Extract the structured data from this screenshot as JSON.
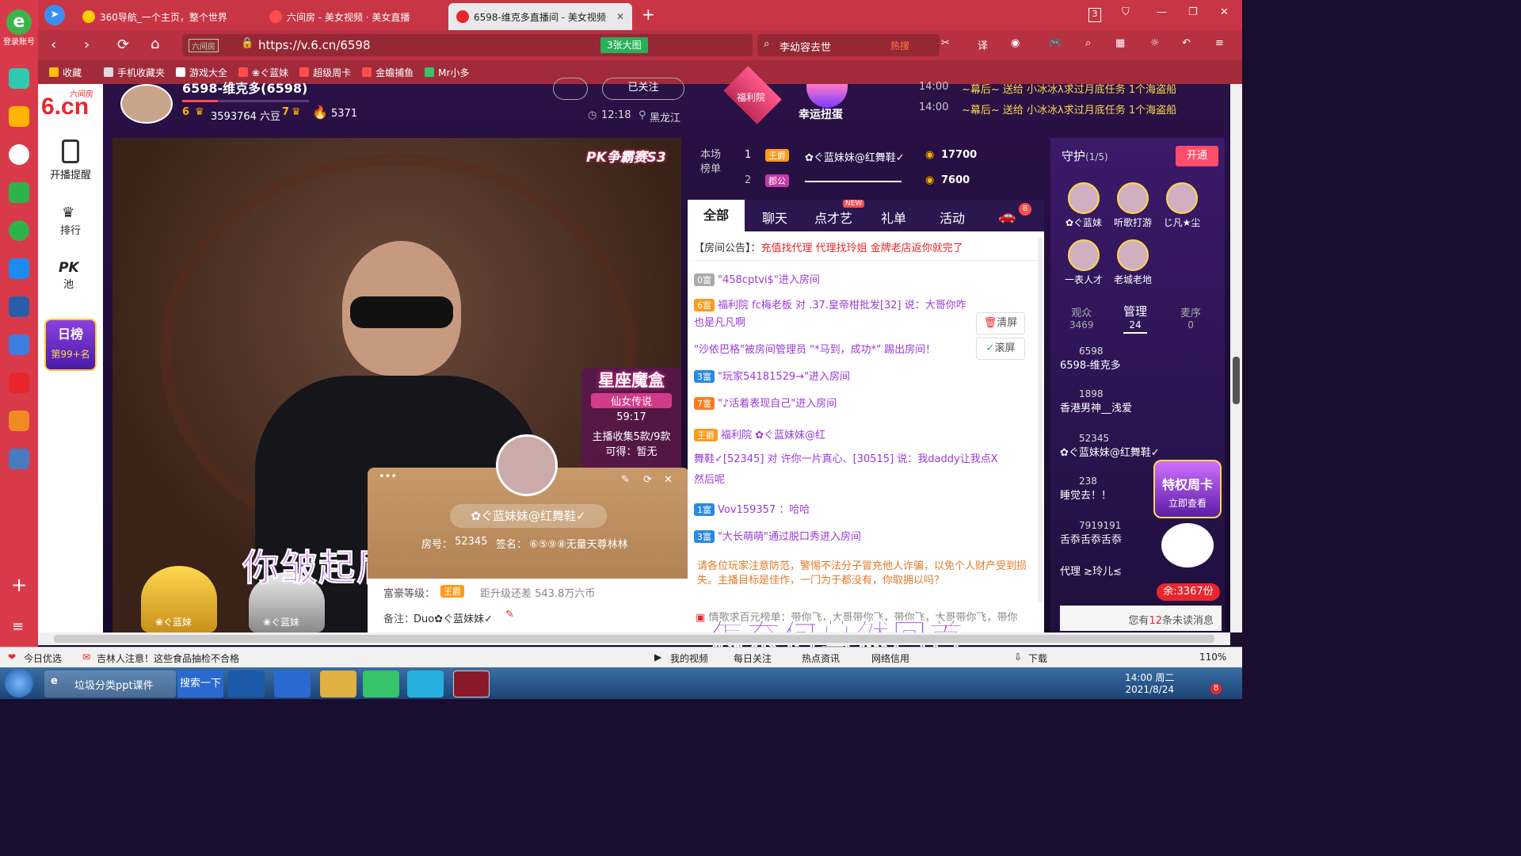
{
  "browser": {
    "login": "登录账号",
    "tabs": [
      "360导航_一个主页，整个世界",
      "六间房 - 美女视频 · 美女直播",
      "6598-维克多直播间 - 美女视频"
    ],
    "tab_count": "3",
    "url_label": "六间房",
    "url": "https://v.6.cn/6598",
    "bigpic": "3张大图",
    "search_text": "李幼容去世",
    "hot": "热搜",
    "bookmarks": [
      "收藏",
      "手机收藏夹",
      "游戏大全",
      "❀ぐ蓝妹",
      "超级周卡",
      "金蟾捕鱼",
      "Mr小多"
    ]
  },
  "header": {
    "logo_small": "六间房",
    "logo": "6.cn",
    "host_name": "6598-维克多(6598)",
    "beans": "3593764 六豆",
    "level_a": "6",
    "level_b": "7",
    "fire": "5371",
    "followed": "已关注",
    "time": "12:18",
    "location": "黑龙江",
    "activity1": "福利院",
    "activity2": "幸运扭蛋",
    "news": [
      {
        "time": "14:00",
        "text": "~幕后~ 送给 小冰冰λ求过月底任务 1个海盗船"
      },
      {
        "time": "14:00",
        "text": "~幕后~ 送给 小冰冰λ求过月底任务 1个海盗船"
      }
    ]
  },
  "sidebar": {
    "items": [
      "开播提醒",
      "排行",
      "PK",
      "池"
    ],
    "rank": "日榜",
    "rank_pos": "第99+名"
  },
  "video": {
    "pk_badge": "PK争霸赛S3",
    "box_title": "星座魔盒",
    "box_sub": "仙女传说",
    "box_time": "59:17",
    "box_collect": "主播收集5款/9款",
    "box_reward": "可得：暂无",
    "lyric1": "你皱起眉头",
    "lyric2": "怎奈何蓦然回首",
    "throne1": "❀ぐ蓝妹",
    "throne2": "❀ぐ蓝妹"
  },
  "profile": {
    "name": "✿ぐ蓝妹妹@红舞鞋✓",
    "room_label": "房号：",
    "room": "52345",
    "sign_label": "签名：",
    "sign": "⑥⑤⑨⑧无量天尊林林",
    "wealth_label": "富豪等级：",
    "wealth_badge": "王爵",
    "upgrade": "距升级还差 543.8万六币",
    "note_label": "备注：",
    "note": "Duo✿ぐ蓝妹妹✓"
  },
  "board": {
    "label1": "本场",
    "label2": "榜单",
    "rows": [
      {
        "n": "1",
        "badge": "王爵",
        "name": "✿ぐ蓝妹妹@红舞鞋✓",
        "score": "17700"
      },
      {
        "n": "2",
        "badge": "郡公",
        "name": "",
        "score": "7600"
      }
    ]
  },
  "chat_tabs": {
    "items": [
      "全部",
      "聊天",
      "点才艺",
      "礼单",
      "活动"
    ],
    "new": "NEW",
    "car_count": "8"
  },
  "chat": {
    "notice_label": "【房间公告】：",
    "notice": "充值找代理 代理找玲姐 金牌老店返你就完了",
    "lines": [
      {
        "lv": "0富",
        "text": "\"458cptvi$\"进入房间"
      },
      {
        "lv": "6富",
        "text": "福利院  fc梅老板 对 .37.皇帝柑批发[32] 说：大哥你咋"
      },
      {
        "lv": "",
        "text": "也是凡凡啊"
      },
      {
        "lv": "",
        "text": "\"沙依巴格\"被房间管理员 \"*马到，成功*\" 踢出房间！"
      },
      {
        "lv": "3富",
        "text": "\"玩家54181529→\"进入房间"
      },
      {
        "lv": "7富",
        "text": "\"♪活着表现自己\"进入房间"
      },
      {
        "lv": "王爵",
        "text": "福利院  ✿ぐ蓝妹妹@红"
      },
      {
        "lv": "",
        "text": "舞鞋✓[52345] 对 许你一片真心、[30515] 说：我daddy让我点X"
      },
      {
        "lv": "",
        "text": "然后呢"
      },
      {
        "lv": "1富",
        "text": "Vov159357 ：哈哈"
      },
      {
        "lv": "3富",
        "text": "\"大长萌萌\"通过脱口秀进入房间"
      }
    ],
    "clear": "清屏",
    "scroll": "滚屏",
    "warning": "请各位玩家注意防范，警惕不法分子冒充他人诈骗，以免个人财产受到损失。主播目标是佳作，一门为于都没有，你取拥以吗？",
    "bottom": "情歌求百元榜单：带你飞，大哥带你飞，带你飞，大哥带你飞，带你"
  },
  "guard": {
    "title": "守护",
    "count": "(1/5)",
    "open": "开通",
    "members": [
      "✿ぐ蓝妹",
      "听歌打游",
      "じ凡★尘",
      "一表人才",
      "老城老地"
    ]
  },
  "audience": {
    "tabs": [
      {
        "label": "观众",
        "n": "3469"
      },
      {
        "label": "管理",
        "n": "24"
      },
      {
        "label": "麦序",
        "n": "0"
      }
    ],
    "list": [
      {
        "n": "6598",
        "name": "6598-维克多"
      },
      {
        "n": "1898",
        "name": "香港男神__浅爱"
      },
      {
        "n": "52345",
        "name": "✿ぐ蓝妹妹@红舞鞋✓"
      },
      {
        "n": "238",
        "name": "睡觉去！！"
      },
      {
        "n": "7919191",
        "name": "舌忝舌忝舌忝"
      },
      {
        "n": "",
        "name": "代理 ≳玲儿≲"
      }
    ],
    "promo": "特权周卡",
    "promo_sub": "立即查看",
    "remain": "余:3367份",
    "unread_pre": "您有",
    "unread_n": "12",
    "unread_post": "条未读消息"
  },
  "statusbar": {
    "left": "今日优选",
    "news": "吉林人注意！这些食品抽检不合格",
    "items": [
      "我的视频",
      "每日关注",
      "热点资讯",
      "网络信用"
    ],
    "download": "下载",
    "zoom": "110%"
  },
  "taskbar": {
    "app": "垃圾分类ppt课件",
    "search": "搜索一下",
    "time": "14:00 周二",
    "date": "2021/8/24",
    "badge": "8"
  }
}
